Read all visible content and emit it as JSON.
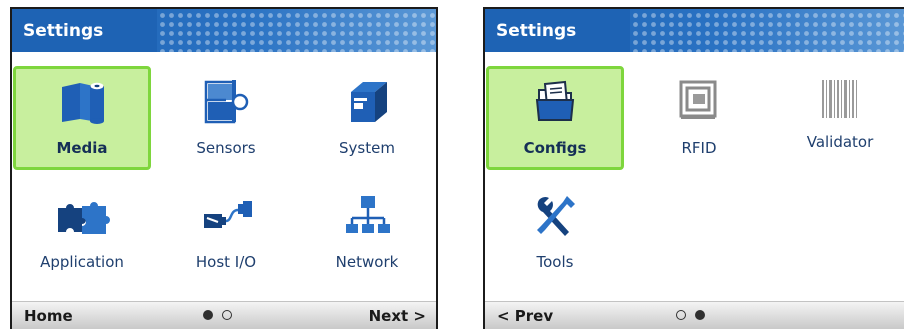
{
  "colors": {
    "titlebar": "#1e63b4",
    "selected_fill": "#c8ef9e",
    "selected_border": "#7ed63d",
    "icon_blue": "#1f5fb5"
  },
  "screens": [
    {
      "title": "Settings",
      "tiles": [
        {
          "label": "Media",
          "icon": "media-roll-icon",
          "selected": true
        },
        {
          "label": "Sensors",
          "icon": "sensor-icon",
          "selected": false
        },
        {
          "label": "System",
          "icon": "printer-icon",
          "selected": false
        },
        {
          "label": "Application",
          "icon": "puzzle-icon",
          "selected": false
        },
        {
          "label": "Host I/O",
          "icon": "host-io-cable-icon",
          "selected": false
        },
        {
          "label": "Network",
          "icon": "network-icon",
          "selected": false
        }
      ],
      "nav_left": "Home",
      "nav_right": "Next >",
      "page_indicator": {
        "current": 1,
        "total": 2
      }
    },
    {
      "title": "Settings",
      "tiles": [
        {
          "label": "Configs",
          "icon": "config-folder-icon",
          "selected": true
        },
        {
          "label": "RFID",
          "icon": "rfid-tag-icon",
          "selected": false
        },
        {
          "label": "Validator",
          "icon": "barcode-icon",
          "selected": false
        },
        {
          "label": "Tools",
          "icon": "tools-icon",
          "selected": false
        }
      ],
      "nav_left": "< Prev",
      "nav_right": "",
      "page_indicator": {
        "current": 2,
        "total": 2
      }
    }
  ]
}
